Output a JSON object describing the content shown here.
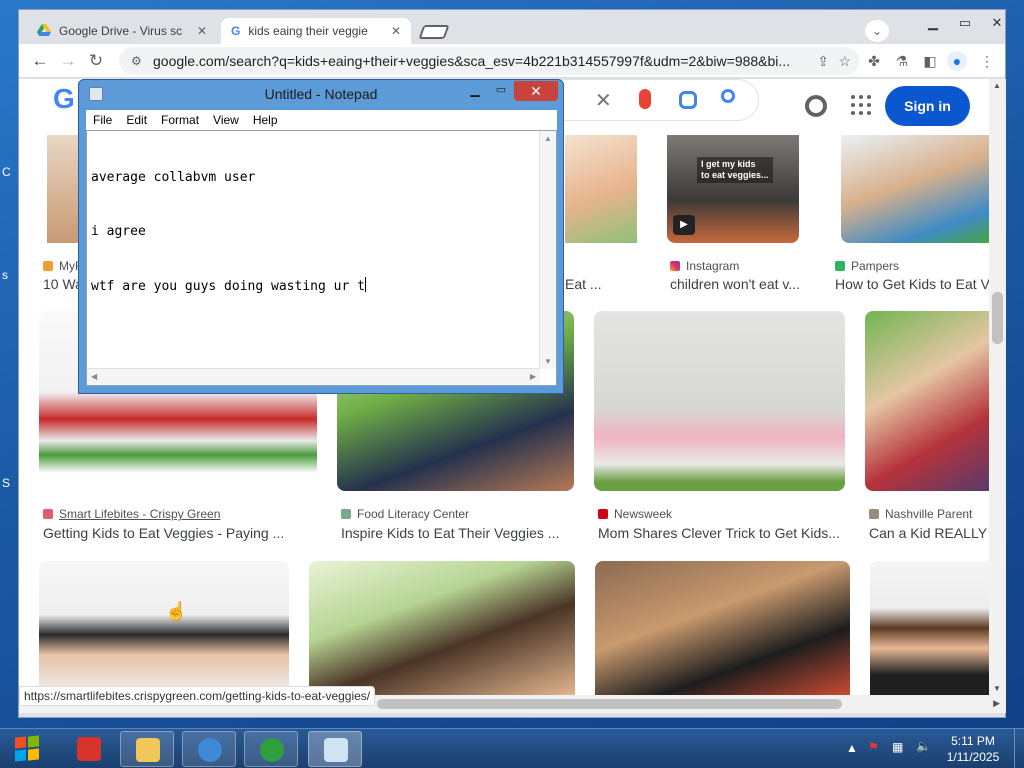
{
  "browser": {
    "tabs": [
      {
        "title": "Google Drive - Virus sc",
        "active": false
      },
      {
        "title": "kids eaing their veggie",
        "active": true
      }
    ],
    "url": "google.com/search?q=kids+eaing+their+veggies&sca_esv=4b221b314557997f&udm=2&biw=988&bi...",
    "status_url": "https://smartlifebites.crispygreen.com/getting-kids-to-eat-veggies/"
  },
  "google": {
    "logo": "G",
    "signin_label": "Sign in",
    "results_row1": [
      {
        "source": "MyF",
        "title": "10 Wa"
      },
      {
        "source": "",
        "title": "Eat ..."
      },
      {
        "source": "Instagram",
        "title": "children won't eat v...",
        "overlay": "I get my kids\nto eat veggies..."
      },
      {
        "source": "Pampers",
        "title": "How to Get Kids to Eat V"
      }
    ],
    "results_row2": [
      {
        "source": "Smart Lifebites - Crispy Green",
        "title": "Getting Kids to Eat Veggies - Paying ..."
      },
      {
        "source": "Food Literacy Center",
        "title": "Inspire Kids to Eat Their Veggies ..."
      },
      {
        "source": "Newsweek",
        "title": "Mom Shares Clever Trick to Get Kids..."
      },
      {
        "source": "Nashville Parent",
        "title": "Can a Kid REALLY L"
      }
    ]
  },
  "notepad": {
    "title": "Untitled - Notepad",
    "menu": [
      "File",
      "Edit",
      "Format",
      "View",
      "Help"
    ],
    "lines": [
      "average collabvm user",
      "i agree",
      "wtf are you guys doing wasting ur t"
    ]
  },
  "taskbar": {
    "time": "5:11 PM",
    "date": "1/11/2025"
  },
  "colors": {
    "accent": "#0b57d0",
    "close": "#c8433b"
  }
}
